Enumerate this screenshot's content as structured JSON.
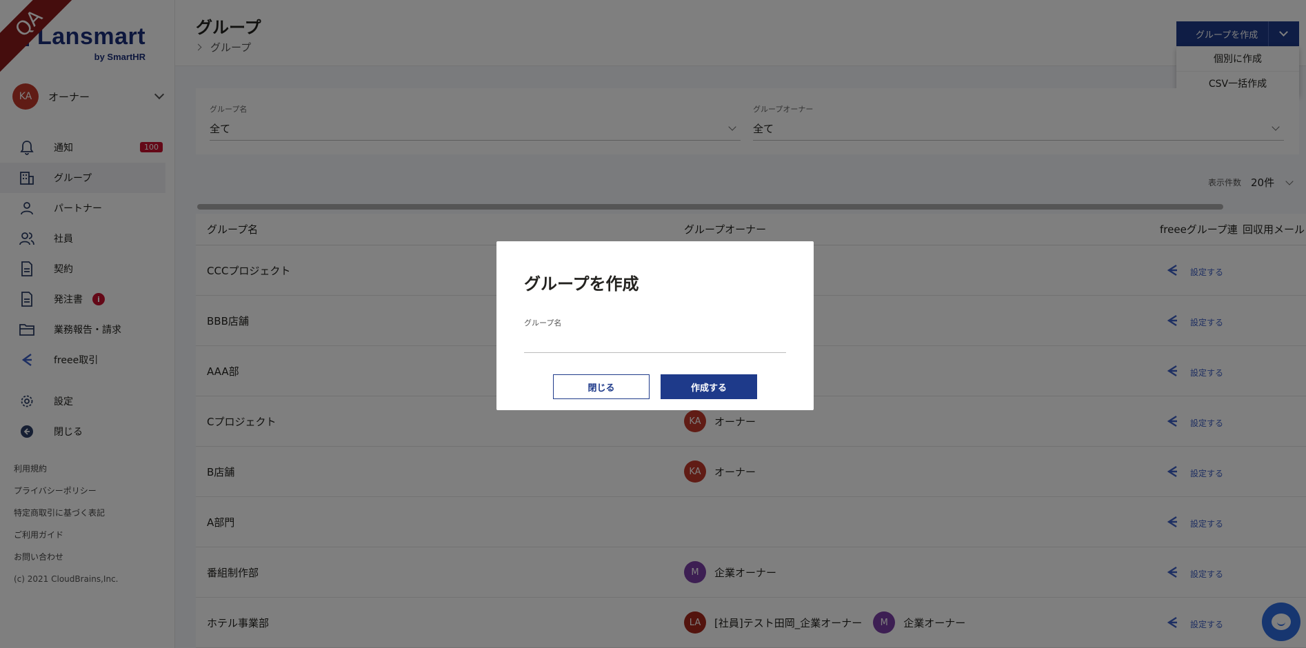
{
  "env_ribbon": "QA",
  "logo": {
    "main": "Lansmart",
    "sub": "by SmartHR"
  },
  "user": {
    "initials": "KA",
    "name": "オーナー"
  },
  "nav": {
    "notifications": {
      "label": "通知",
      "badge": "100",
      "icon": "bell-icon"
    },
    "groups": {
      "label": "グループ",
      "icon": "building-icon"
    },
    "partners": {
      "label": "パートナー",
      "icon": "person-icon"
    },
    "employees": {
      "label": "社員",
      "icon": "people-icon"
    },
    "contracts": {
      "label": "契約",
      "icon": "document-icon"
    },
    "orders": {
      "label": "発注書",
      "icon": "document-icon",
      "info_badge": "i"
    },
    "reports": {
      "label": "業務報告・請求",
      "icon": "folder-icon"
    },
    "freee": {
      "label": "freee取引",
      "icon": "freee-icon"
    },
    "settings": {
      "label": "設定",
      "icon": "gear-icon"
    },
    "close": {
      "label": "閉じる",
      "icon": "back-arrow-icon"
    }
  },
  "footer": {
    "terms": "利用規約",
    "privacy": "プライバシーポリシー",
    "commerce": "特定商取引に基づく表記",
    "guide": "ご利用ガイド",
    "contact": "お問い合わせ",
    "copyright": "(c) 2021 CloudBrains,Inc."
  },
  "header": {
    "title": "グループ",
    "breadcrumb": "グループ",
    "create_button": "グループを作成",
    "dropdown": [
      "個別に作成",
      "CSV一括作成"
    ]
  },
  "filters": {
    "group_name": {
      "label": "グループ名",
      "value": "全て"
    },
    "group_owner": {
      "label": "グループオーナー",
      "value": "全て"
    }
  },
  "page_size": {
    "label": "表示件数",
    "value": "20件"
  },
  "table": {
    "headers": {
      "name": "グループ名",
      "owner": "グループオーナー",
      "freee": "freeeグループ連",
      "email": "回収用メール"
    },
    "rows": [
      {
        "name": "CCCプロジェクト",
        "freee": "設定する"
      },
      {
        "name": "BBB店舗",
        "freee": "設定する"
      },
      {
        "name": "AAA部",
        "freee": "設定する"
      },
      {
        "name": "Cプロジェクト",
        "owners": [
          {
            "initials": "KA",
            "name": "オーナー",
            "color": "#c0392b"
          }
        ],
        "freee": "設定する"
      },
      {
        "name": "B店舗",
        "owners": [
          {
            "initials": "KA",
            "name": "オーナー",
            "color": "#c0392b"
          }
        ],
        "freee": "設定する"
      },
      {
        "name": "A部門",
        "freee": "設定する"
      },
      {
        "name": "番組制作部",
        "owners": [
          {
            "initials": "M",
            "name": "企業オーナー",
            "color": "#7b3fa6"
          }
        ],
        "freee": "設定する"
      },
      {
        "name": "ホテル事業部",
        "owners": [
          {
            "initials": "LA",
            "name": "[社員]テスト田岡_企業オーナー",
            "color": "#a7281d"
          },
          {
            "initials": "M",
            "name": "企業オーナー",
            "color": "#7b3fa6"
          }
        ],
        "freee": "設定する"
      }
    ]
  },
  "modal": {
    "title": "グループを作成",
    "field_label": "グループ名",
    "field_value": "",
    "close_button": "閉じる",
    "create_button": "作成する"
  },
  "colors": {
    "primary": "#1e3a8a",
    "badge": "#c8102e",
    "freee": "#3d5fc4"
  }
}
